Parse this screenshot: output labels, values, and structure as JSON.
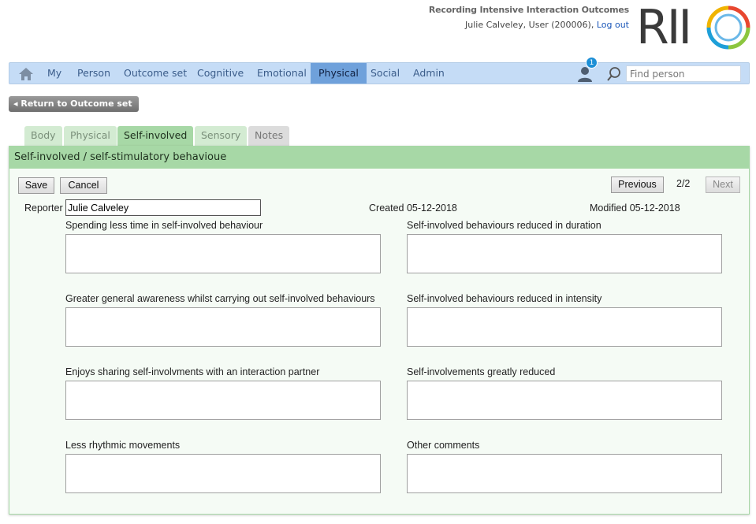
{
  "header": {
    "app_title": "Recording Intensive Interaction Outcomes",
    "user_text": "Julie Calveley, User (200006),",
    "logout_label": "Log out",
    "logo_text": "RII"
  },
  "nav": {
    "items": [
      "My",
      "Person",
      "Outcome set",
      "Cognitive",
      "Emotional",
      "Physical",
      "Social",
      "Admin"
    ],
    "active": "Physical",
    "badge_count": "1",
    "search_placeholder": "Find person"
  },
  "return_button": "◂ Return to Outcome set",
  "tabs": [
    "Body",
    "Physical",
    "Self-involved",
    "Sensory",
    "Notes"
  ],
  "active_tab": "Self-involved",
  "panel": {
    "title": "Self-involved / self-stimulatory behavioue",
    "save_label": "Save",
    "cancel_label": "Cancel",
    "previous_label": "Previous",
    "page_indicator": "2/2",
    "next_label": "Next",
    "reporter_label": "Reporter",
    "reporter_value": "Julie Calveley",
    "created": "Created 05-12-2018",
    "modified": "Modified 05-12-2018",
    "fields": [
      "Spending less time in self-involved behaviour",
      "Self-involved behaviours reduced in duration",
      "Greater general awareness whilst carrying out self-involved behaviours",
      "Self-involved behaviours reduced in intensity",
      "Enjoys sharing self-involvments with an interaction partner",
      "Self-involvements greatly reduced",
      "Less rhythmic movements",
      "Other comments"
    ]
  },
  "colors": {
    "nav_bg": "#c5dcf6",
    "nav_active": "#6fa1db",
    "tab_active": "#a7d8a6",
    "panel_bg": "#f5fbf5",
    "link": "#1a56b8"
  }
}
